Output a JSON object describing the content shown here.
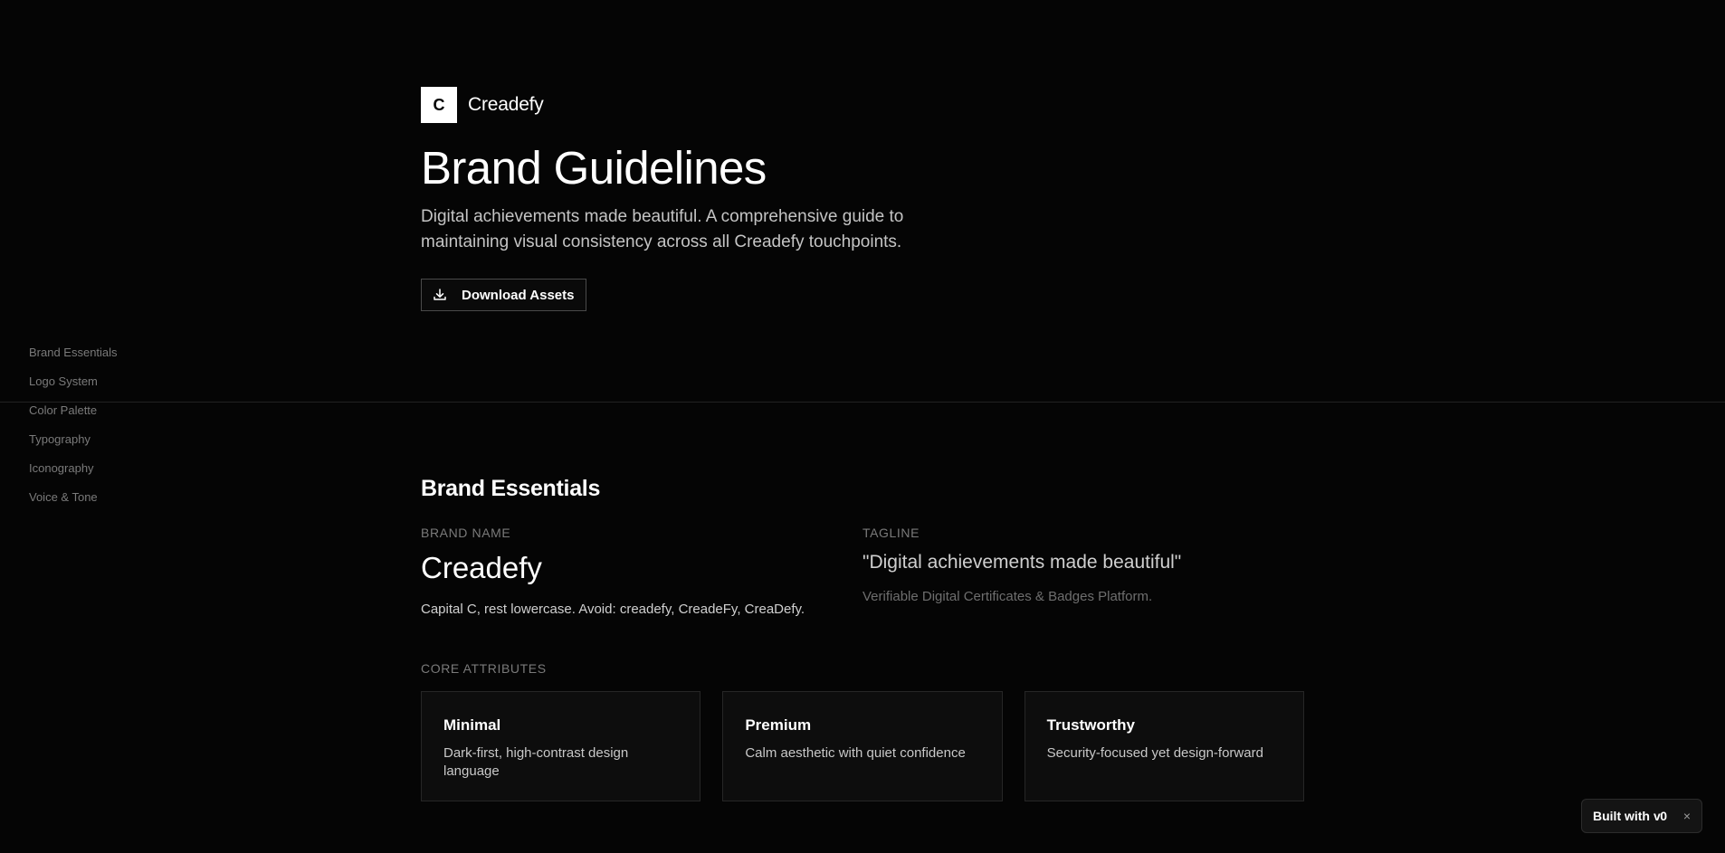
{
  "sidebar": {
    "items": [
      {
        "label": "Brand Essentials"
      },
      {
        "label": "Logo System"
      },
      {
        "label": "Color Palette"
      },
      {
        "label": "Typography"
      },
      {
        "label": "Iconography"
      },
      {
        "label": "Voice & Tone"
      }
    ]
  },
  "hero": {
    "logo_letter": "C",
    "logo_text": "Creadefy",
    "title": "Brand Guidelines",
    "subtitle": "Digital achievements made beautiful. A comprehensive guide to maintaining visual consistency across all Creadefy touchpoints.",
    "download_label": "Download Assets"
  },
  "essentials": {
    "title": "Brand Essentials",
    "brand_name_label": "BRAND NAME",
    "brand_name": "Creadefy",
    "brand_note": "Capital C, rest lowercase. Avoid: creadefy, CreadeFy, CreaDefy.",
    "tagline_label": "TAGLINE",
    "tagline": "\"Digital achievements made beautiful\"",
    "tagline_note": "Verifiable Digital Certificates & Badges Platform.",
    "core_label": "CORE ATTRIBUTES",
    "attributes": [
      {
        "title": "Minimal",
        "desc": "Dark-first, high-contrast design language"
      },
      {
        "title": "Premium",
        "desc": "Calm aesthetic with quiet confidence"
      },
      {
        "title": "Trustworthy",
        "desc": "Security-focused yet design-forward"
      }
    ]
  },
  "badge": {
    "text": "Built with",
    "mark": "v0",
    "close": "×"
  },
  "icons": {
    "download": "download-icon",
    "close": "close-icon"
  },
  "colors": {
    "background": "#050505",
    "text": "#ffffff",
    "muted": "#7a7a7a",
    "card_bg": "#0d0d0d",
    "border": "#262626"
  }
}
